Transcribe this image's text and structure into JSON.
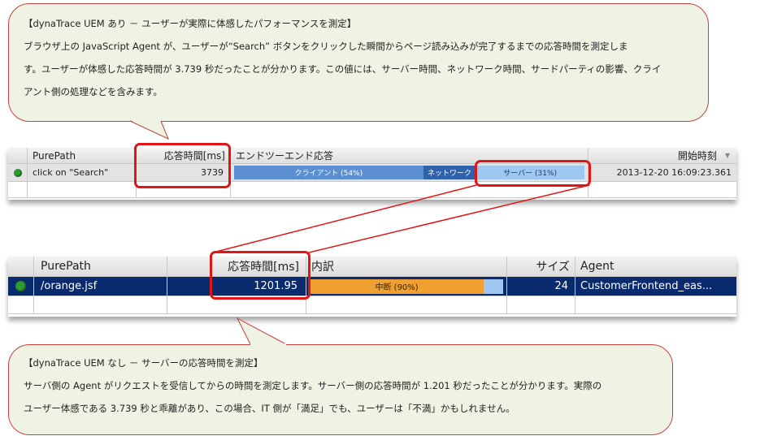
{
  "callout_top": {
    "lines": [
      "【dynaTrace UEM あり － ユーザーが実際に体感したパフォーマンスを測定】",
      "ブラウザ上の JavaScript Agent が、ユーザーが“Search” ボタンをクリックした瞬間からページ読み込みが完了するまでの応答時間を測定しま",
      "す。ユーザーが体感した応答時間が 3.739 秒だったことが分かります。この値には、サーバー時間、ネットワーク時間、サードパーティの影響、クライ",
      "アント側の処理などを含みます。"
    ]
  },
  "grid_top": {
    "headers": {
      "purepath": "PurePath",
      "response": "応答時間[ms]",
      "e2e": "エンドツーエンド応答",
      "start": "開始時刻",
      "sort_icon": "▼"
    },
    "row": {
      "name": "click on \"Search\"",
      "response": "3739",
      "client_label": "クライアント (54%)",
      "client_pct": 54,
      "network_label": "ネットワーク",
      "network_pct": 15,
      "server_label": "サーバー (31%)",
      "server_pct": 31,
      "start": "2013-12-20 16:09:23.361"
    },
    "colors": {
      "client": "#5b8fd2",
      "network": "#2f62ac",
      "server": "#9ec8ef",
      "status": "#2e9c2e"
    }
  },
  "grid_bottom": {
    "headers": {
      "purepath": "PurePath",
      "response": "応答時間[ms]",
      "breakdown": "内訳",
      "size": "サイズ",
      "agent": "Agent"
    },
    "row": {
      "name": "/orange.jsf",
      "response": "1201.95",
      "bar_label": "中断 (90%)",
      "bar_pct": 90,
      "size": "24",
      "agent": "CustomerFrontend_eas..."
    },
    "colors": {
      "bar": "#f0a030",
      "status": "#2e9c2e"
    }
  },
  "callout_bottom": {
    "lines": [
      "【dynaTrace UEM なし － サーバーの応答時間を測定】",
      "サーバ側の Agent がリクエストを受信してからの時間を測定します。サーバー側の応答時間が 1.201 秒だったことが分かります。実際の",
      "ユーザー体感である 3.739 秒と乖離があり、この場合、IT 側が「満足」でも、ユーザーは「不満」かもしれません。"
    ]
  }
}
